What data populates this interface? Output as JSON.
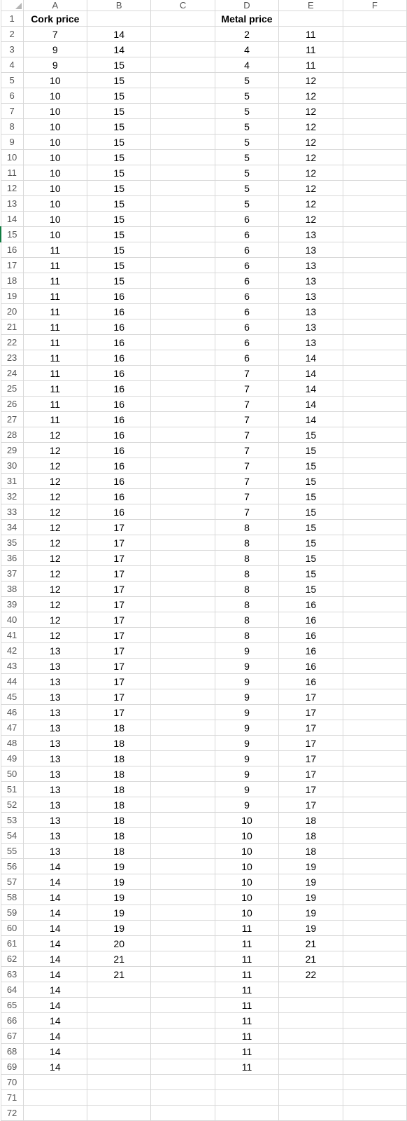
{
  "columns": [
    "A",
    "B",
    "C",
    "D",
    "E",
    "F"
  ],
  "active_row": 15,
  "rows": [
    {
      "n": 1,
      "cells": [
        "Cork price",
        "",
        "",
        "Metal price",
        "",
        ""
      ],
      "header": true
    },
    {
      "n": 2,
      "cells": [
        "7",
        "14",
        "",
        "2",
        "11",
        ""
      ]
    },
    {
      "n": 3,
      "cells": [
        "9",
        "14",
        "",
        "4",
        "11",
        ""
      ]
    },
    {
      "n": 4,
      "cells": [
        "9",
        "15",
        "",
        "4",
        "11",
        ""
      ]
    },
    {
      "n": 5,
      "cells": [
        "10",
        "15",
        "",
        "5",
        "12",
        ""
      ]
    },
    {
      "n": 6,
      "cells": [
        "10",
        "15",
        "",
        "5",
        "12",
        ""
      ]
    },
    {
      "n": 7,
      "cells": [
        "10",
        "15",
        "",
        "5",
        "12",
        ""
      ]
    },
    {
      "n": 8,
      "cells": [
        "10",
        "15",
        "",
        "5",
        "12",
        ""
      ]
    },
    {
      "n": 9,
      "cells": [
        "10",
        "15",
        "",
        "5",
        "12",
        ""
      ]
    },
    {
      "n": 10,
      "cells": [
        "10",
        "15",
        "",
        "5",
        "12",
        ""
      ]
    },
    {
      "n": 11,
      "cells": [
        "10",
        "15",
        "",
        "5",
        "12",
        ""
      ]
    },
    {
      "n": 12,
      "cells": [
        "10",
        "15",
        "",
        "5",
        "12",
        ""
      ]
    },
    {
      "n": 13,
      "cells": [
        "10",
        "15",
        "",
        "5",
        "12",
        ""
      ]
    },
    {
      "n": 14,
      "cells": [
        "10",
        "15",
        "",
        "6",
        "12",
        ""
      ]
    },
    {
      "n": 15,
      "cells": [
        "10",
        "15",
        "",
        "6",
        "13",
        ""
      ]
    },
    {
      "n": 16,
      "cells": [
        "11",
        "15",
        "",
        "6",
        "13",
        ""
      ]
    },
    {
      "n": 17,
      "cells": [
        "11",
        "15",
        "",
        "6",
        "13",
        ""
      ]
    },
    {
      "n": 18,
      "cells": [
        "11",
        "15",
        "",
        "6",
        "13",
        ""
      ]
    },
    {
      "n": 19,
      "cells": [
        "11",
        "16",
        "",
        "6",
        "13",
        ""
      ]
    },
    {
      "n": 20,
      "cells": [
        "11",
        "16",
        "",
        "6",
        "13",
        ""
      ]
    },
    {
      "n": 21,
      "cells": [
        "11",
        "16",
        "",
        "6",
        "13",
        ""
      ]
    },
    {
      "n": 22,
      "cells": [
        "11",
        "16",
        "",
        "6",
        "13",
        ""
      ]
    },
    {
      "n": 23,
      "cells": [
        "11",
        "16",
        "",
        "6",
        "14",
        ""
      ]
    },
    {
      "n": 24,
      "cells": [
        "11",
        "16",
        "",
        "7",
        "14",
        ""
      ]
    },
    {
      "n": 25,
      "cells": [
        "11",
        "16",
        "",
        "7",
        "14",
        ""
      ]
    },
    {
      "n": 26,
      "cells": [
        "11",
        "16",
        "",
        "7",
        "14",
        ""
      ]
    },
    {
      "n": 27,
      "cells": [
        "11",
        "16",
        "",
        "7",
        "14",
        ""
      ]
    },
    {
      "n": 28,
      "cells": [
        "12",
        "16",
        "",
        "7",
        "15",
        ""
      ]
    },
    {
      "n": 29,
      "cells": [
        "12",
        "16",
        "",
        "7",
        "15",
        ""
      ]
    },
    {
      "n": 30,
      "cells": [
        "12",
        "16",
        "",
        "7",
        "15",
        ""
      ]
    },
    {
      "n": 31,
      "cells": [
        "12",
        "16",
        "",
        "7",
        "15",
        ""
      ]
    },
    {
      "n": 32,
      "cells": [
        "12",
        "16",
        "",
        "7",
        "15",
        ""
      ]
    },
    {
      "n": 33,
      "cells": [
        "12",
        "16",
        "",
        "7",
        "15",
        ""
      ]
    },
    {
      "n": 34,
      "cells": [
        "12",
        "17",
        "",
        "8",
        "15",
        ""
      ]
    },
    {
      "n": 35,
      "cells": [
        "12",
        "17",
        "",
        "8",
        "15",
        ""
      ]
    },
    {
      "n": 36,
      "cells": [
        "12",
        "17",
        "",
        "8",
        "15",
        ""
      ]
    },
    {
      "n": 37,
      "cells": [
        "12",
        "17",
        "",
        "8",
        "15",
        ""
      ]
    },
    {
      "n": 38,
      "cells": [
        "12",
        "17",
        "",
        "8",
        "15",
        ""
      ]
    },
    {
      "n": 39,
      "cells": [
        "12",
        "17",
        "",
        "8",
        "16",
        ""
      ]
    },
    {
      "n": 40,
      "cells": [
        "12",
        "17",
        "",
        "8",
        "16",
        ""
      ]
    },
    {
      "n": 41,
      "cells": [
        "12",
        "17",
        "",
        "8",
        "16",
        ""
      ]
    },
    {
      "n": 42,
      "cells": [
        "13",
        "17",
        "",
        "9",
        "16",
        ""
      ]
    },
    {
      "n": 43,
      "cells": [
        "13",
        "17",
        "",
        "9",
        "16",
        ""
      ]
    },
    {
      "n": 44,
      "cells": [
        "13",
        "17",
        "",
        "9",
        "16",
        ""
      ]
    },
    {
      "n": 45,
      "cells": [
        "13",
        "17",
        "",
        "9",
        "17",
        ""
      ]
    },
    {
      "n": 46,
      "cells": [
        "13",
        "17",
        "",
        "9",
        "17",
        ""
      ]
    },
    {
      "n": 47,
      "cells": [
        "13",
        "18",
        "",
        "9",
        "17",
        ""
      ]
    },
    {
      "n": 48,
      "cells": [
        "13",
        "18",
        "",
        "9",
        "17",
        ""
      ]
    },
    {
      "n": 49,
      "cells": [
        "13",
        "18",
        "",
        "9",
        "17",
        ""
      ]
    },
    {
      "n": 50,
      "cells": [
        "13",
        "18",
        "",
        "9",
        "17",
        ""
      ]
    },
    {
      "n": 51,
      "cells": [
        "13",
        "18",
        "",
        "9",
        "17",
        ""
      ]
    },
    {
      "n": 52,
      "cells": [
        "13",
        "18",
        "",
        "9",
        "17",
        ""
      ]
    },
    {
      "n": 53,
      "cells": [
        "13",
        "18",
        "",
        "10",
        "18",
        ""
      ]
    },
    {
      "n": 54,
      "cells": [
        "13",
        "18",
        "",
        "10",
        "18",
        ""
      ]
    },
    {
      "n": 55,
      "cells": [
        "13",
        "18",
        "",
        "10",
        "18",
        ""
      ]
    },
    {
      "n": 56,
      "cells": [
        "14",
        "19",
        "",
        "10",
        "19",
        ""
      ]
    },
    {
      "n": 57,
      "cells": [
        "14",
        "19",
        "",
        "10",
        "19",
        ""
      ]
    },
    {
      "n": 58,
      "cells": [
        "14",
        "19",
        "",
        "10",
        "19",
        ""
      ]
    },
    {
      "n": 59,
      "cells": [
        "14",
        "19",
        "",
        "10",
        "19",
        ""
      ]
    },
    {
      "n": 60,
      "cells": [
        "14",
        "19",
        "",
        "11",
        "19",
        ""
      ]
    },
    {
      "n": 61,
      "cells": [
        "14",
        "20",
        "",
        "11",
        "21",
        ""
      ]
    },
    {
      "n": 62,
      "cells": [
        "14",
        "21",
        "",
        "11",
        "21",
        ""
      ]
    },
    {
      "n": 63,
      "cells": [
        "14",
        "21",
        "",
        "11",
        "22",
        ""
      ]
    },
    {
      "n": 64,
      "cells": [
        "14",
        "",
        "",
        "11",
        "",
        ""
      ]
    },
    {
      "n": 65,
      "cells": [
        "14",
        "",
        "",
        "11",
        "",
        ""
      ]
    },
    {
      "n": 66,
      "cells": [
        "14",
        "",
        "",
        "11",
        "",
        ""
      ]
    },
    {
      "n": 67,
      "cells": [
        "14",
        "",
        "",
        "11",
        "",
        ""
      ]
    },
    {
      "n": 68,
      "cells": [
        "14",
        "",
        "",
        "11",
        "",
        ""
      ]
    },
    {
      "n": 69,
      "cells": [
        "14",
        "",
        "",
        "11",
        "",
        ""
      ]
    },
    {
      "n": 70,
      "cells": [
        "",
        "",
        "",
        "",
        "",
        ""
      ]
    },
    {
      "n": 71,
      "cells": [
        "",
        "",
        "",
        "",
        "",
        ""
      ]
    },
    {
      "n": 72,
      "cells": [
        "",
        "",
        "",
        "",
        "",
        ""
      ]
    }
  ]
}
